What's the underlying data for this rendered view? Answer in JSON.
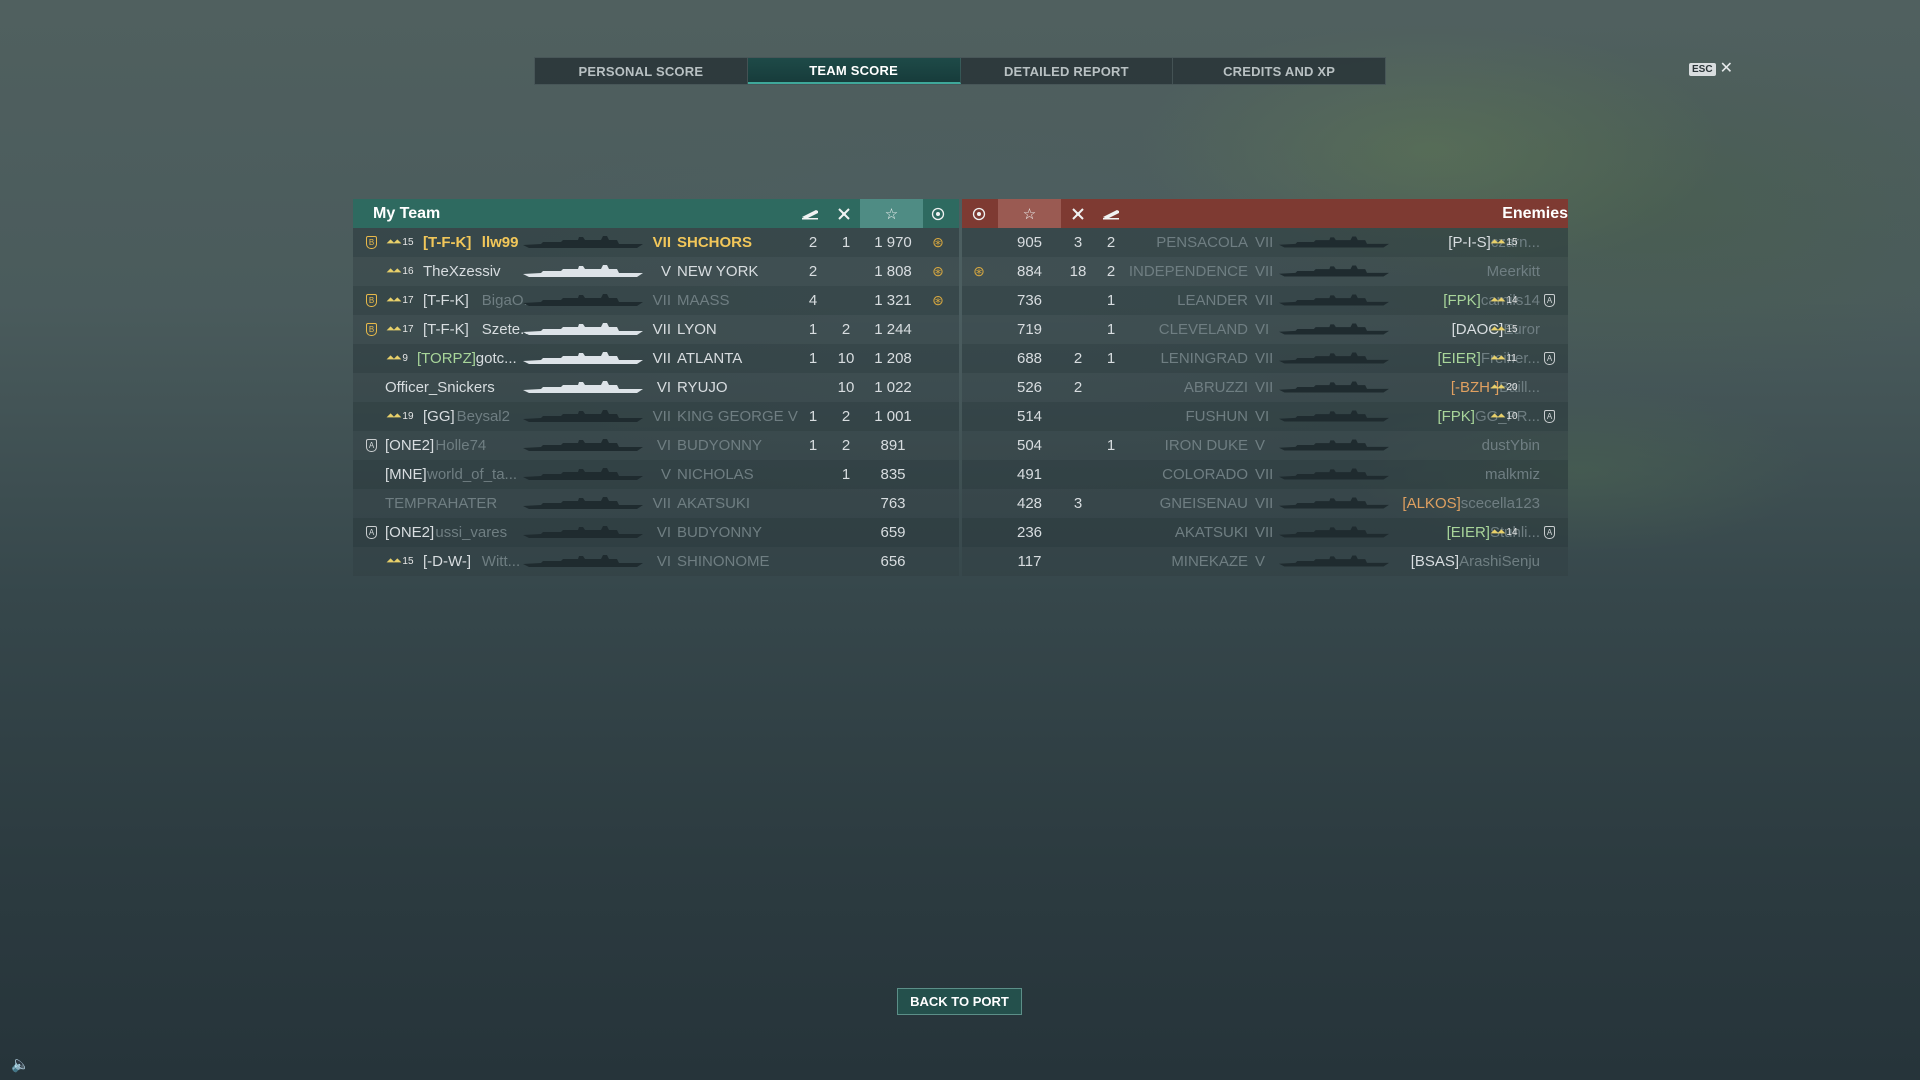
{
  "tabs": [
    {
      "label": "PERSONAL SCORE",
      "active": false
    },
    {
      "label": "TEAM SCORE",
      "active": true
    },
    {
      "label": "DETAILED REPORT",
      "active": false
    },
    {
      "label": "CREDITS AND XP",
      "active": false
    }
  ],
  "esc": {
    "key_label": "ESC",
    "close_glyph": "✕"
  },
  "my_team": {
    "title": "My Team",
    "header_icons": [
      "ship-kill-icon",
      "plane-kill-icon",
      "star-icon",
      "ribbon-icon"
    ],
    "rows": [
      {
        "rank": "15",
        "clan": "[T-F-K]",
        "name": "llw99",
        "tier": "VII",
        "ship": "SHCHORS",
        "kills": "2",
        "planes": "1",
        "score": "1 970",
        "ribbon": true,
        "self": true,
        "dim": false,
        "badge": "gold",
        "shiplight": false
      },
      {
        "rank": "16",
        "clan": "",
        "name": "TheXzessiv",
        "tier": "V",
        "ship": "NEW YORK",
        "kills": "2",
        "planes": "",
        "score": "1 808",
        "ribbon": true,
        "self": false,
        "dim": false,
        "badge": "",
        "shiplight": true
      },
      {
        "rank": "17",
        "clan": "[T-F-K]",
        "name": "BigaO...",
        "tier": "VII",
        "ship": "MAASS",
        "kills": "4",
        "planes": "",
        "score": "1 321",
        "ribbon": true,
        "self": false,
        "dim": true,
        "badge": "gold",
        "shiplight": false
      },
      {
        "rank": "17",
        "clan": "[T-F-K]",
        "name": "Szete...",
        "tier": "VII",
        "ship": "LYON",
        "kills": "1",
        "planes": "2",
        "score": "1 244",
        "ribbon": false,
        "self": false,
        "dim": false,
        "badge": "gold",
        "shiplight": true
      },
      {
        "rank": "9",
        "clan": "[TORPZ]",
        "name": "gotc...",
        "tier": "VII",
        "ship": "ATLANTA",
        "kills": "1",
        "planes": "10",
        "score": "1 208",
        "ribbon": false,
        "self": false,
        "dim": false,
        "badge": "",
        "shiplight": true
      },
      {
        "rank": "",
        "clan": "",
        "name": "Officer_Snickers",
        "tier": "VI",
        "ship": "RYUJO",
        "kills": "",
        "planes": "10",
        "score": "1 022",
        "ribbon": false,
        "self": false,
        "dim": false,
        "badge": "",
        "shiplight": true
      },
      {
        "rank": "19",
        "clan": "[GG]",
        "name": "Beysal2",
        "tier": "VII",
        "ship": "KING GEORGE V",
        "kills": "1",
        "planes": "2",
        "score": "1 001",
        "ribbon": false,
        "self": false,
        "dim": true,
        "badge": "",
        "shiplight": false
      },
      {
        "rank": "",
        "clan": "[ONE2]",
        "name": "Holle74",
        "tier": "VI",
        "ship": "BUDYONNY",
        "kills": "1",
        "planes": "2",
        "score": "891",
        "ribbon": false,
        "self": false,
        "dim": true,
        "badge": "silver",
        "shiplight": false
      },
      {
        "rank": "",
        "clan": "[MNE]",
        "name": "world_of_ta...",
        "tier": "V",
        "ship": "NICHOLAS",
        "kills": "",
        "planes": "1",
        "score": "835",
        "ribbon": false,
        "self": false,
        "dim": true,
        "badge": "",
        "shiplight": false
      },
      {
        "rank": "",
        "clan": "",
        "name": "TEMPRAHATER",
        "tier": "VII",
        "ship": "AKATSUKI",
        "kills": "",
        "planes": "",
        "score": "763",
        "ribbon": false,
        "self": false,
        "dim": true,
        "badge": "",
        "shiplight": false
      },
      {
        "rank": "",
        "clan": "[ONE2]",
        "name": "ussi_vares",
        "tier": "VI",
        "ship": "BUDYONNY",
        "kills": "",
        "planes": "",
        "score": "659",
        "ribbon": false,
        "self": false,
        "dim": true,
        "badge": "silver",
        "shiplight": false
      },
      {
        "rank": "15",
        "clan": "[-D-W-]",
        "name": "Witt...",
        "tier": "VI",
        "ship": "SHINONOME",
        "kills": "",
        "planes": "",
        "score": "656",
        "ribbon": false,
        "self": false,
        "dim": true,
        "badge": "",
        "shiplight": false
      }
    ]
  },
  "enemies": {
    "title": "Enemies",
    "header_icons": [
      "ribbon-icon",
      "star-icon",
      "plane-kill-icon",
      "ship-kill-icon"
    ],
    "rows": [
      {
        "ribbon": false,
        "score": "905",
        "planes": "3",
        "kills": "2",
        "ship": "PENSACOLA",
        "tier": "VII",
        "clan": "[P-I-S]",
        "name": "czarn...",
        "rank": "15",
        "badge": "",
        "dim": true,
        "clanColor": "white"
      },
      {
        "ribbon": true,
        "score": "884",
        "planes": "18",
        "kills": "2",
        "ship": "INDEPENDENCE",
        "tier": "VII",
        "clan": "",
        "name": "Meerkitt",
        "rank": "",
        "badge": "",
        "dim": true,
        "clanColor": "white"
      },
      {
        "ribbon": false,
        "score": "736",
        "planes": "",
        "kills": "1",
        "ship": "LEANDER",
        "tier": "VII",
        "clan": "[FPK]",
        "name": "camils14",
        "rank": "14",
        "badge": "silver",
        "dim": true,
        "clanColor": "green"
      },
      {
        "ribbon": false,
        "score": "719",
        "planes": "",
        "kills": "1",
        "ship": "CLEVELAND",
        "tier": "VI",
        "clan": "[DAOC]",
        "name": "Euror",
        "rank": "15",
        "badge": "",
        "dim": true,
        "clanColor": "white"
      },
      {
        "ribbon": false,
        "score": "688",
        "planes": "2",
        "kills": "1",
        "ship": "LENINGRAD",
        "tier": "VII",
        "clan": "[EIER]",
        "name": "Freiher...",
        "rank": "11",
        "badge": "silver",
        "dim": true,
        "clanColor": "green"
      },
      {
        "ribbon": false,
        "score": "526",
        "planes": "2",
        "kills": "",
        "ship": "ABRUZZI",
        "tier": "VII",
        "clan": "[-BZH-]",
        "name": "Baill...",
        "rank": "20",
        "badge": "",
        "dim": true,
        "clanColor": "orange"
      },
      {
        "ribbon": false,
        "score": "514",
        "planes": "",
        "kills": "",
        "ship": "FUSHUN",
        "tier": "VI",
        "clan": "[FPK]",
        "name": "GG_PR...",
        "rank": "10",
        "badge": "silver",
        "dim": true,
        "clanColor": "green"
      },
      {
        "ribbon": false,
        "score": "504",
        "planes": "",
        "kills": "1",
        "ship": "IRON DUKE",
        "tier": "V",
        "clan": "",
        "name": "dustYbin",
        "rank": "",
        "badge": "",
        "dim": true,
        "clanColor": "white"
      },
      {
        "ribbon": false,
        "score": "491",
        "planes": "",
        "kills": "",
        "ship": "COLORADO",
        "tier": "VII",
        "clan": "",
        "name": "malkmiz",
        "rank": "",
        "badge": "",
        "dim": true,
        "clanColor": "white"
      },
      {
        "ribbon": false,
        "score": "428",
        "planes": "3",
        "kills": "",
        "ship": "GNEISENAU",
        "tier": "VII",
        "clan": "[ALKOS]",
        "name": "scecella123",
        "rank": "",
        "badge": "",
        "dim": true,
        "clanColor": "orange"
      },
      {
        "ribbon": false,
        "score": "236",
        "planes": "",
        "kills": "",
        "ship": "AKATSUKI",
        "tier": "VII",
        "clan": "[EIER]",
        "name": "Stuhli...",
        "rank": "14",
        "badge": "silver",
        "dim": true,
        "clanColor": "green"
      },
      {
        "ribbon": false,
        "score": "117",
        "planes": "",
        "kills": "",
        "ship": "MINEKAZE",
        "tier": "V",
        "clan": "[BSAS]",
        "name": "ArashiSenju",
        "rank": "",
        "badge": "",
        "dim": true,
        "clanColor": "white"
      }
    ]
  },
  "back_button": "BACK TO PORT",
  "colors": {
    "my_team_header": "#2e6a60",
    "enemy_header": "#7e3a32",
    "self_highlight": "#f2c75a",
    "active_tab": "#1e4a48"
  }
}
